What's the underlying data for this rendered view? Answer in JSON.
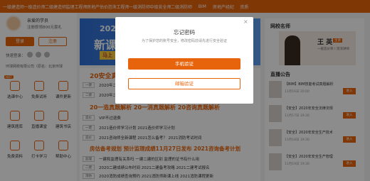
{
  "topnav": [
    "一级建造师",
    "一级造价师",
    "二级建造师",
    "监理工程师",
    "房地产估价师",
    "咨询工程师",
    "一级消防师",
    "中级安全师",
    "二级消防师",
    "BIM",
    "房地产经纪人/协理",
    "资质"
  ],
  "user": {
    "greeting": "亲爱的学员",
    "register_hint": "注册即领800元豪礼",
    "login": "登录",
    "register": "注册",
    "quick_login": "快速登录：",
    "org_text": "环球网校有限公司（原名：北京环球"
  },
  "grid": [
    {
      "label": "选课中心",
      "hot": "HOT"
    },
    {
      "label": "免费试听"
    },
    {
      "label": "课件更新"
    },
    {
      "label": "建筑题库"
    },
    {
      "label": "直播课堂"
    },
    {
      "label": "建筑书店"
    },
    {
      "label": "免费资料"
    },
    {
      "label": "打卡学习"
    },
    {
      "label": "帮助中心"
    }
  ],
  "banner": {
    "line1": "2021",
    "line2": "新课",
    "line3": "马上"
  },
  "news": {
    "h1": "20安全真题",
    "r1": [
      "一建",
      "2020年二建考试真题"
    ],
    "r2": [
      "二建",
      "2020年二建考试真题"
    ],
    "h2": "20一造真题解析   20一消真题解析   20咨询真题解析",
    "r3": [
      "造价",
      "VIP不过退费"
    ],
    "r4": [
      "一建",
      "2021造价师学习计划   2021造价师学习计划"
    ],
    "r5": [
      "造价",
      "2021咨询师全新课程   2021怎么备考？   2021消防考试时间"
    ],
    "h3": "房估备考规划   预计监理成绩11月27日发布   2021咨询备考计划",
    "r6": [
      "监理",
      "一建和监理有关系吗   一建二建的区别   监理的证书有什么用"
    ],
    "r7": [
      "二建",
      "2020二建成绩公布时间   2021二建备考攻略   2021二建考试报名"
    ],
    "r8": [
      "消防",
      "2020消防成绩查询预约   2021消防师新课上线   2021消防课程更新"
    ]
  },
  "right": {
    "title": "网校名师",
    "teacher_name": "王  英",
    "teacher_badge": "主讲",
    "teacher_desc": "一级造价师 / 资深讲师",
    "live_title": "直播公告",
    "lives": [
      {
        "title": "【BIM】BIM技能考试真题解析",
        "date": "11月16日 20:00",
        "go": "进入"
      },
      {
        "title": "【安全】2020年安全法律法规",
        "date": "11月17日 19:30",
        "go": "进入"
      },
      {
        "title": "【安全】2020年安全生产技术",
        "date": "11月18日 19:30",
        "go": "进入"
      },
      {
        "title": "【安全】2020年安全生产管理",
        "date": "11月19日 19:30",
        "go": "进入"
      }
    ]
  },
  "modal": {
    "title": "忘记密码",
    "subtitle": "为了保护您的账号安全，修改密码前请先进行安全验证",
    "close": "×",
    "phone_btn": "手机验证",
    "email_btn": "邮箱验证"
  }
}
